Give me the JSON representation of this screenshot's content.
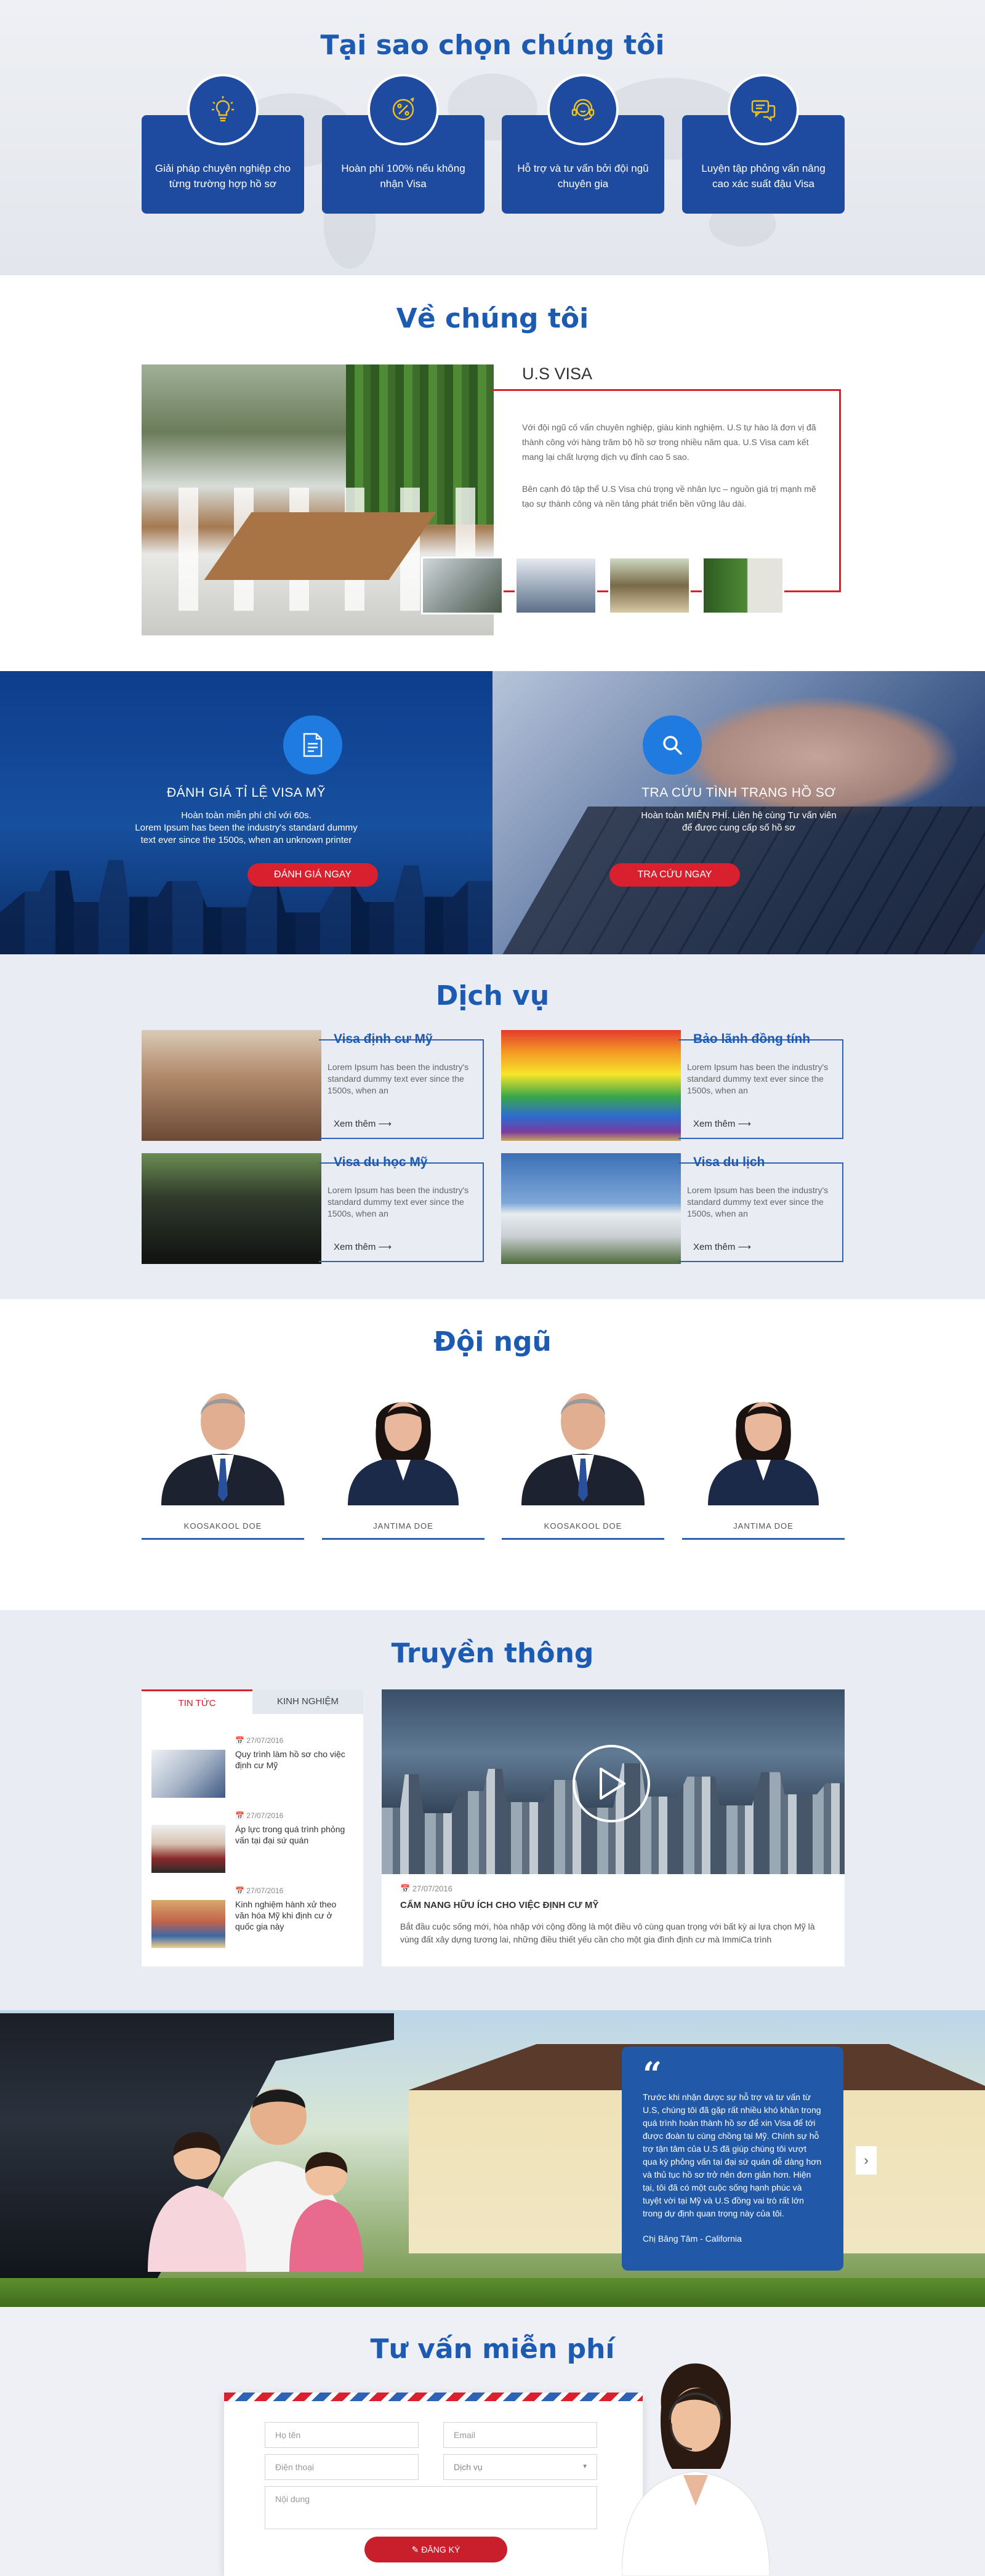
{
  "why": {
    "title": "Tại sao chọn chúng tôi",
    "cards": [
      {
        "icon": "lightbulb-icon",
        "text": "Giải pháp chuyên nghiệp cho từng trường hợp hồ sơ"
      },
      {
        "icon": "percent-icon",
        "text": "Hoàn phí 100% nếu không nhận Visa"
      },
      {
        "icon": "headset-support-icon",
        "text": "Hỗ trợ và tư vấn bởi đội ngũ chuyên gia"
      },
      {
        "icon": "chat-icon",
        "text": "Luyện tập phỏng vấn nâng cao xác suất đậu Visa"
      }
    ]
  },
  "about": {
    "title": "Về chúng tôi",
    "heading": "U.S VISA",
    "p1": "Với đội ngũ cố vấn chuyên nghiệp, giàu kinh nghiệm. U.S tự hào là đơn vị đã thành công với hàng trăm bộ hồ sơ trong nhiều năm qua. U.S Visa cam kết mang lại chất lượng dịch vụ đỉnh cao 5 sao.",
    "p2": "Bên cạnh đó tập thể U.S Visa chú trọng về nhân lực – nguồn giá trị mạnh mẽ tạo sự thành công và nền tảng phát triển bền vững lâu dài."
  },
  "banners": {
    "left": {
      "icon": "document-icon",
      "title": "ĐÁNH GIÁ TỈ LỆ VISA MỸ",
      "line1": "Hoàn toàn miễn phí chỉ với 60s.",
      "line2": "Lorem Ipsum has been the industry's standard dummy",
      "line3": "text ever since the 1500s, when an unknown printer",
      "button": "ĐÁNH GIÁ NGAY"
    },
    "right": {
      "icon": "search-icon",
      "title": "TRA CỨU TÌNH TRẠNG HỒ SƠ",
      "line1": "Hoàn toàn MIỄN PHÍ. Liên hệ cùng Tư vấn viên",
      "line2": "để được cung cấp số hồ sơ",
      "button": "TRA CỨU NGAY"
    }
  },
  "services": {
    "title": "Dịch vụ",
    "items": [
      {
        "title": "Visa định cư Mỹ",
        "text": "Lorem Ipsum has been the industry's standard dummy text ever since the 1500s, when an",
        "more": "Xem thêm"
      },
      {
        "title": "Bảo lãnh đồng tính",
        "text": "Lorem Ipsum has been the industry's standard dummy text ever since the 1500s, when an",
        "more": "Xem thêm"
      },
      {
        "title": "Visa du học Mỹ",
        "text": "Lorem Ipsum has been the industry's standard dummy text ever since the 1500s, when an",
        "more": "Xem thêm"
      },
      {
        "title": "Visa du lịch",
        "text": "Lorem Ipsum has been the industry's standard dummy text ever since the 1500s, when an",
        "more": "Xem thêm"
      }
    ]
  },
  "team": {
    "title": "Đội ngũ",
    "members": [
      {
        "name": "KOOSAKOOL DOE"
      },
      {
        "name": "JANTIMA DOE"
      },
      {
        "name": "KOOSAKOOL DOE"
      },
      {
        "name": "JANTIMA DOE"
      }
    ]
  },
  "media": {
    "title": "Truyền thông",
    "tabs": [
      "TIN TỨC",
      "KINH NGHIỆM"
    ],
    "news": [
      {
        "date": "27/07/2016",
        "title": "Quy trình làm hồ sơ cho việc định cư Mỹ"
      },
      {
        "date": "27/07/2016",
        "title": "Áp lực trong quá trình phỏng vấn tại đại sứ quán"
      },
      {
        "date": "27/07/2016",
        "title": "Kinh nghiệm hành xử theo văn hóa Mỹ khi định cư ở quốc gia này"
      }
    ],
    "featured": {
      "date": "27/07/2016",
      "title": "CẨM NANG HỮU ÍCH CHO VIỆC ĐỊNH CƯ MỸ",
      "text": "Bắt đầu cuộc sống mới, hòa nhập với cộng đồng là một điều vô cùng quan trọng với bất kỳ ai lựa chọn Mỹ là vùng đất xây dựng tương lai, những điều thiết yếu cần cho một gia đình định cư mà ImmiCa trình"
    }
  },
  "testimonial": {
    "text": "Trước khi nhận được sự hỗ trợ và tư vấn từ U.S, chúng tôi đã gặp rất nhiều khó khăn trong quá trình hoàn thành hồ sơ để xin Visa để tới được đoàn tụ cùng chồng tại Mỹ. Chính sự hỗ trợ tận tâm của U.S đã giúp chúng tôi vượt qua kỳ phỏng vấn tại đại sứ quán dễ dàng hơn và thủ tục hồ sơ trở nên đơn giản hơn. Hiện tại, tôi đã có một cuộc sống hạnh phúc và tuyệt vời tại Mỹ và U.S đồng vai trò rất lớn trong dự định quan trọng này của tôi.",
    "author": "Chị Băng Tâm - California"
  },
  "contact": {
    "title": "Tư vấn miễn phí",
    "name_ph": "Họ tên",
    "email_ph": "Email",
    "phone_ph": "Điện thoại",
    "service_ph": "Dịch vụ",
    "message_ph": "Nội dung",
    "submit": "ĐĂNG KÝ"
  },
  "colors": {
    "primary": "#1e4ba0",
    "accent": "#d9202e",
    "heading": "#1d5bb3"
  }
}
